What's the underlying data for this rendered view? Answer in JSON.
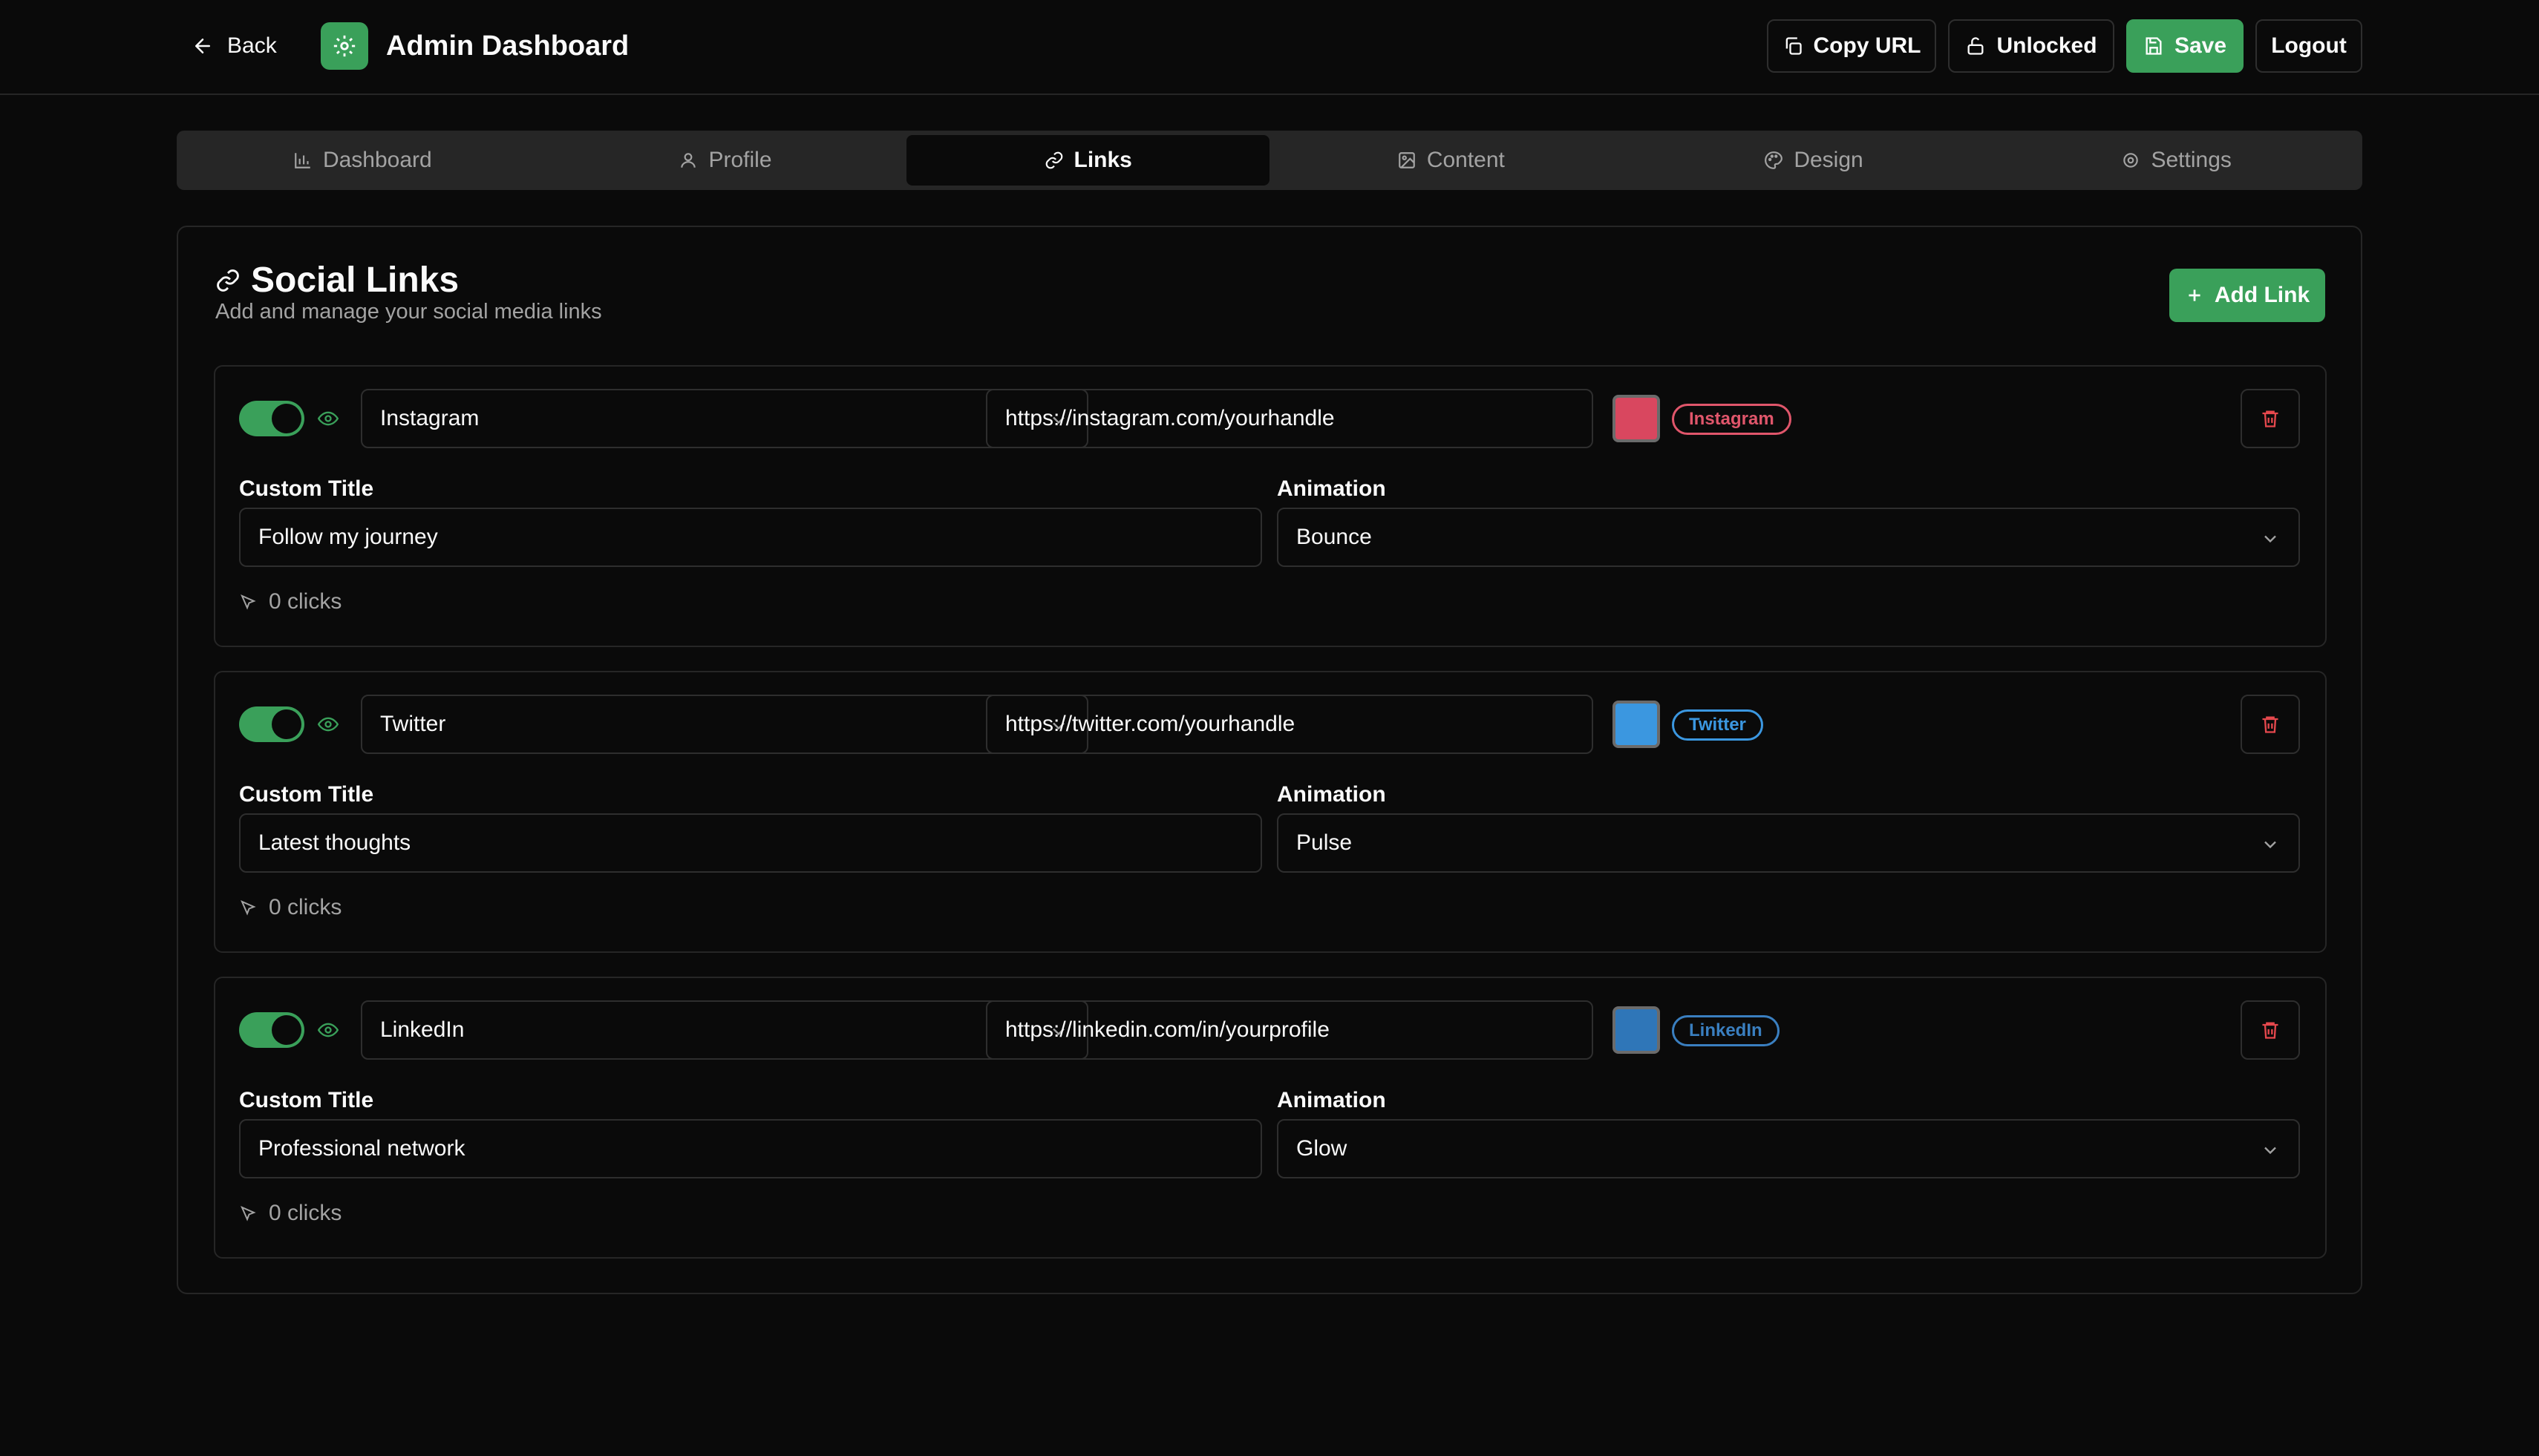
{
  "header": {
    "back_label": "Back",
    "title": "Admin Dashboard",
    "copy_url_label": "Copy URL",
    "unlocked_label": "Unlocked",
    "save_label": "Save",
    "logout_label": "Logout",
    "accent_color": "#3aa05a"
  },
  "tabs": [
    {
      "label": "Dashboard",
      "icon": "bar-chart-icon",
      "active": false
    },
    {
      "label": "Profile",
      "icon": "user-icon",
      "active": false
    },
    {
      "label": "Links",
      "icon": "link-icon",
      "active": true
    },
    {
      "label": "Content",
      "icon": "image-icon",
      "active": false
    },
    {
      "label": "Design",
      "icon": "palette-icon",
      "active": false
    },
    {
      "label": "Settings",
      "icon": "gear-icon",
      "active": false
    }
  ],
  "section": {
    "title": "Social Links",
    "subtitle": "Add and manage your social media links",
    "add_link_label": "Add Link"
  },
  "labels": {
    "custom_title": "Custom Title",
    "animation": "Animation"
  },
  "links": [
    {
      "enabled": true,
      "platform": "Instagram",
      "url": "https://instagram.com/yourhandle",
      "color": "#d9475f",
      "badge": "Instagram",
      "badge_color": "#e0566b",
      "custom_title": "Follow my journey",
      "animation": "Bounce",
      "clicks": "0 clicks"
    },
    {
      "enabled": true,
      "platform": "Twitter",
      "url": "https://twitter.com/yourhandle",
      "color": "#3b97e0",
      "badge": "Twitter",
      "badge_color": "#3b97e0",
      "custom_title": "Latest thoughts",
      "animation": "Pulse",
      "clicks": "0 clicks"
    },
    {
      "enabled": true,
      "platform": "LinkedIn",
      "url": "https://linkedin.com/in/yourprofile",
      "color": "#2f76b8",
      "badge": "LinkedIn",
      "badge_color": "#3a7fc0",
      "custom_title": "Professional network",
      "animation": "Glow",
      "clicks": "0 clicks"
    }
  ]
}
